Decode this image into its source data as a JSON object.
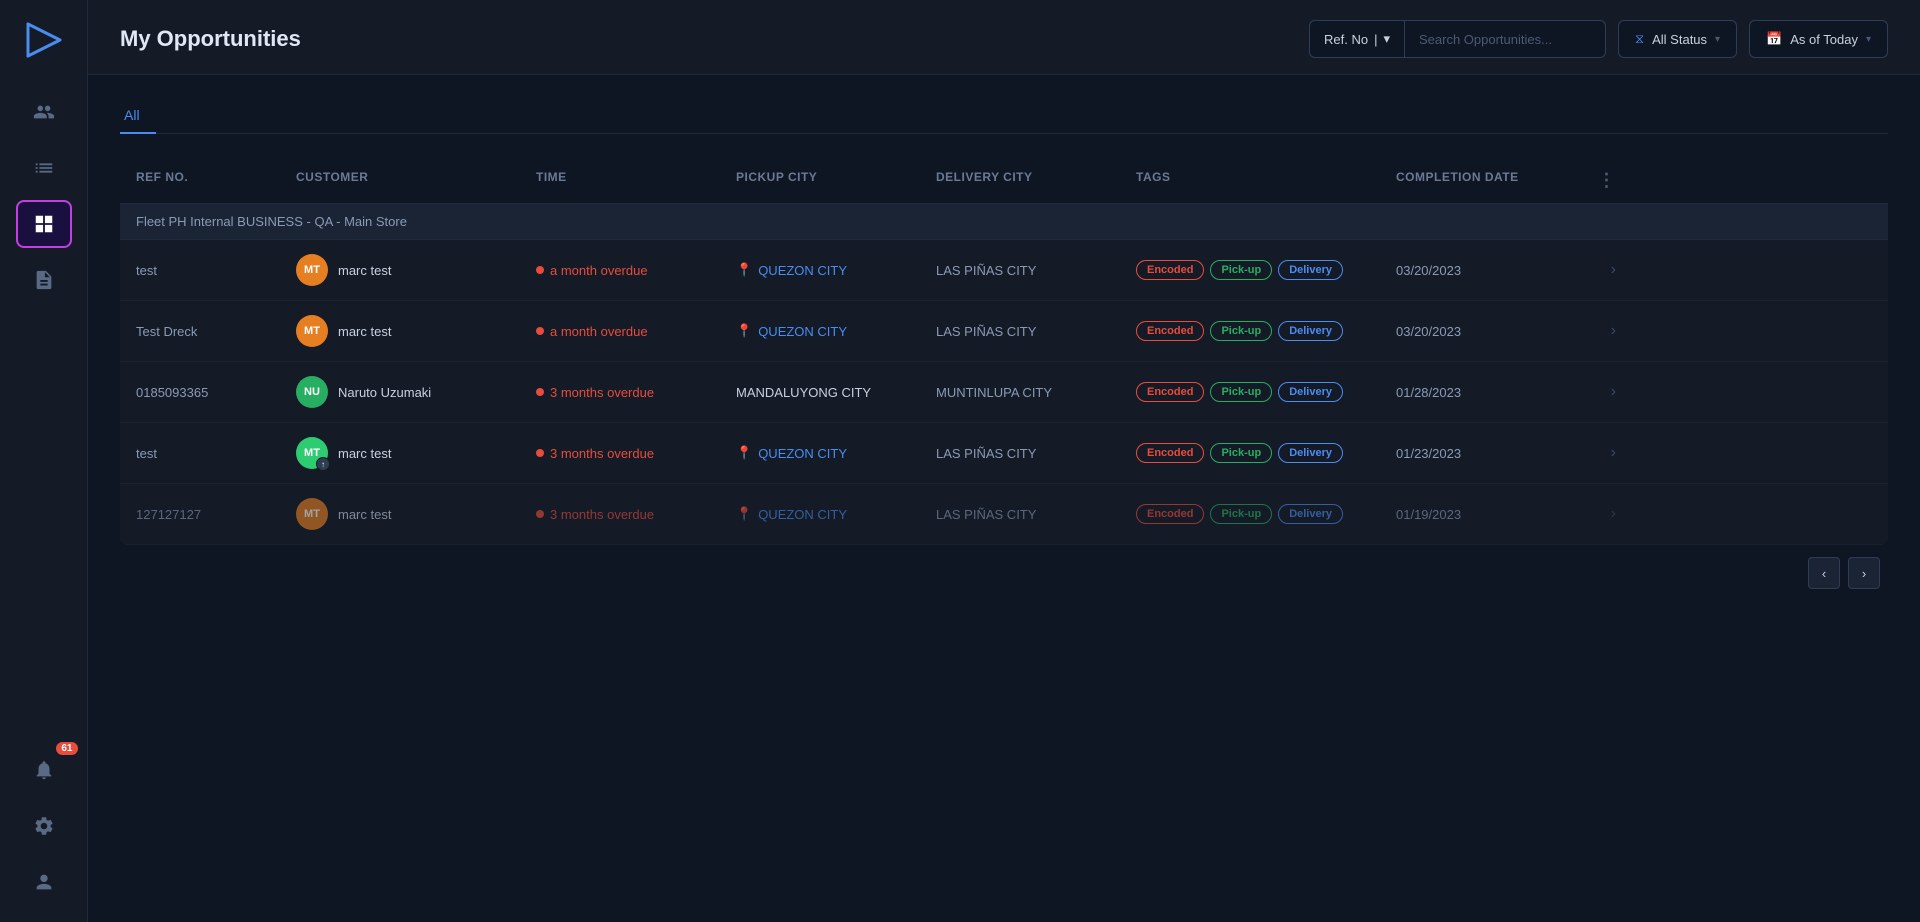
{
  "sidebar": {
    "logo_text": "▶",
    "nav_items": [
      {
        "id": "people",
        "icon": "👥",
        "label": "People"
      },
      {
        "id": "list",
        "icon": "☰",
        "label": "List"
      },
      {
        "id": "board",
        "icon": "⊞",
        "label": "Board",
        "active": true
      },
      {
        "id": "file",
        "icon": "📄",
        "label": "File"
      }
    ],
    "bottom_items": [
      {
        "id": "notifications",
        "icon": "🔔",
        "label": "Notifications",
        "badge": "61"
      },
      {
        "id": "settings",
        "icon": "⚙",
        "label": "Settings"
      },
      {
        "id": "profile",
        "icon": "👤",
        "label": "Profile"
      }
    ]
  },
  "header": {
    "title": "My Opportunities",
    "search": {
      "filter_label": "Ref. No",
      "placeholder": "Search Opportunities...",
      "chevron": "▾"
    },
    "status_filter": {
      "label": "All Status",
      "chevron": "▾"
    },
    "date_filter": {
      "label": "As of Today",
      "chevron": "▾"
    }
  },
  "tabs": [
    {
      "id": "all",
      "label": "All",
      "active": true
    }
  ],
  "table": {
    "columns": [
      "Ref No.",
      "Customer",
      "Time",
      "Pickup City",
      "Delivery City",
      "Tags",
      "Completion Date",
      ""
    ],
    "group_label": "Fleet PH Internal BUSINESS - QA - Main Store",
    "rows": [
      {
        "ref_no": "test",
        "avatar_initials": "MT",
        "avatar_color": "orange",
        "customer_name": "marc test",
        "time_status": "a month overdue",
        "pickup_city": "QUEZON CITY",
        "delivery_city": "LAS PIÑAS CITY",
        "tags": [
          "Encoded",
          "Pick-up",
          "Delivery"
        ],
        "completion_date": "03/20/2023",
        "has_upload": false
      },
      {
        "ref_no": "Test Dreck",
        "avatar_initials": "MT",
        "avatar_color": "orange",
        "customer_name": "marc test",
        "time_status": "a month overdue",
        "pickup_city": "QUEZON CITY",
        "delivery_city": "LAS PIÑAS CITY",
        "tags": [
          "Encoded",
          "Pick-up",
          "Delivery"
        ],
        "completion_date": "03/20/2023",
        "has_upload": false
      },
      {
        "ref_no": "0185093365",
        "avatar_initials": "NU",
        "avatar_color": "green-dark",
        "customer_name": "Naruto Uzumaki",
        "time_status": "3 months overdue",
        "pickup_city": "MANDALUYONG CITY",
        "delivery_city": "MUNTINLUPA CITY",
        "tags": [
          "Encoded",
          "Pick-up",
          "Delivery"
        ],
        "completion_date": "01/28/2023",
        "has_upload": false
      },
      {
        "ref_no": "test",
        "avatar_initials": "MT",
        "avatar_color": "orange",
        "customer_name": "marc test",
        "time_status": "3 months overdue",
        "pickup_city": "QUEZON CITY",
        "delivery_city": "LAS PIÑAS CITY",
        "tags": [
          "Encoded",
          "Pick-up",
          "Delivery"
        ],
        "completion_date": "01/23/2023",
        "has_upload": true
      },
      {
        "ref_no": "127127127",
        "avatar_initials": "MT",
        "avatar_color": "orange",
        "customer_name": "marc test",
        "time_status": "3 months overdue",
        "pickup_city": "QUEZON CITY",
        "delivery_city": "LAS PIÑAS CITY",
        "tags": [
          "Encoded",
          "Pick-up",
          "Delivery"
        ],
        "completion_date": "01/19/2023",
        "has_upload": false
      }
    ]
  },
  "pagination": {
    "prev_label": "‹",
    "next_label": "›"
  },
  "colors": {
    "accent_blue": "#4a8cf0",
    "accent_purple": "#c43fe0",
    "overdue_red": "#e74c3c",
    "tag_encoded_color": "#e74c3c",
    "tag_pickup_color": "#27ae60",
    "tag_delivery_color": "#4a8cf0",
    "sidebar_bg": "#141b27",
    "main_bg": "#0f1623"
  }
}
